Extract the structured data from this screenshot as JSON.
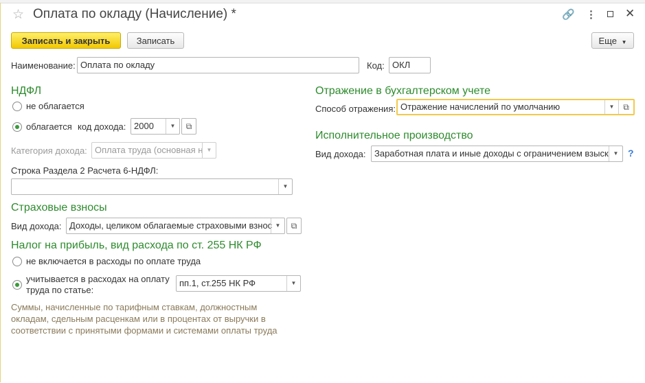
{
  "window": {
    "title": "Оплата по окладу (Начисление) *"
  },
  "toolbar": {
    "save_close_label": "Записать и закрыть",
    "save_label": "Записать",
    "more_label": "Еще"
  },
  "form": {
    "name_label": "Наименование:",
    "name_value": "Оплата по окладу",
    "code_label": "Код:",
    "code_value": "ОКЛ"
  },
  "ndfl": {
    "heading": "НДФЛ",
    "option_not_taxed": "не облагается",
    "option_taxed": "облагается",
    "income_code_label": "код дохода:",
    "income_code_value": "2000",
    "category_label": "Категория дохода:",
    "category_value": "Оплата труда (основная н",
    "line_label": "Строка Раздела 2 Расчета 6-НДФЛ:",
    "line_value": ""
  },
  "insurance": {
    "heading": "Страховые взносы",
    "income_type_label": "Вид дохода:",
    "income_type_value": "Доходы, целиком облагаемые страховыми взнос"
  },
  "profit_tax": {
    "heading": "Налог на прибыль, вид расхода по ст. 255 НК РФ",
    "option_not_included": "не включается в расходы по оплате труда",
    "option_included_line1": "учитывается в расходах на оплату",
    "option_included_line2": "труда по статье:",
    "article_value": "пп.1, ст.255 НК РФ",
    "note": "Суммы, начисленные по тарифным ставкам, должностным окладам, сдельным расценкам или в процентах от выручки в соответствии с принятыми формами и системами оплаты труда"
  },
  "accounting": {
    "heading": "Отражение в бухгалтерском учете",
    "method_label": "Способ отражения:",
    "method_value": "Отражение начислений по умолчанию"
  },
  "enforcement": {
    "heading": "Исполнительное производство",
    "income_type_label": "Вид дохода:",
    "income_type_value": "Заработная плата и иные доходы с ограничением взыск",
    "help_label": "?"
  },
  "colors": {
    "section_heading": "#2e8b2e",
    "primary_button": "#f2c800",
    "focus_border": "#f2c94c",
    "note_text": "#8a7a5a"
  }
}
